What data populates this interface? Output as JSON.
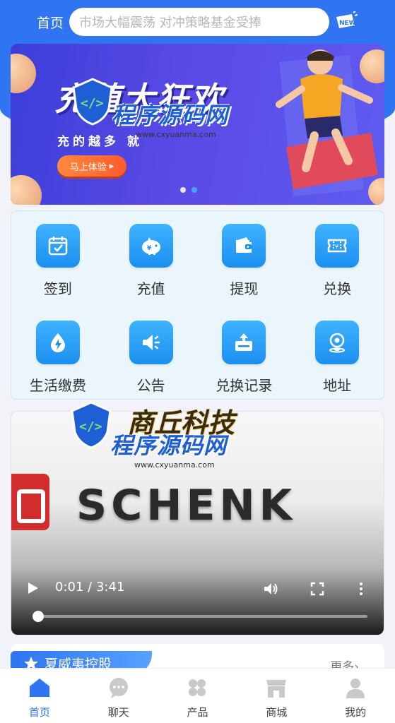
{
  "header": {
    "title": "首页",
    "marquee_text": "市场大幅震荡 对冲策略基金受捧",
    "new_badge": "NEW"
  },
  "banner": {
    "title": "充值大狂欢",
    "subtitle": "充的越多  就",
    "button_label": "马上体验",
    "slides_total": 2,
    "active_slide": 2
  },
  "watermarks": [
    {
      "text": "程序源码网",
      "url": "www.cxyuanma.com"
    },
    {
      "text": "程序源码网",
      "url": "www.cxyuanma.com"
    }
  ],
  "video_watermark_brand": "商丘科技",
  "quick_actions": [
    {
      "label": "签到",
      "icon": "calendar-check-icon"
    },
    {
      "label": "充值",
      "icon": "piggy-bank-icon"
    },
    {
      "label": "提现",
      "icon": "wallet-icon"
    },
    {
      "label": "兑换",
      "icon": "ticket-icon"
    },
    {
      "label": "生活缴费",
      "icon": "flame-drop-icon"
    },
    {
      "label": "公告",
      "icon": "speaker-icon"
    },
    {
      "label": "兑换记录",
      "icon": "upload-box-icon"
    },
    {
      "label": "地址",
      "icon": "location-pin-icon"
    }
  ],
  "video": {
    "brand_text": "SCHENK",
    "current_time": "0:01",
    "separator": "/",
    "duration": "3:41",
    "progress_fraction": 0.005
  },
  "news": {
    "tag_label": "夏威夷控股",
    "more_label": "更多"
  },
  "tabbar": [
    {
      "label": "首页",
      "icon": "home-icon",
      "active": true
    },
    {
      "label": "聊天",
      "icon": "chat-icon",
      "active": false
    },
    {
      "label": "产品",
      "icon": "grid-icon",
      "active": false
    },
    {
      "label": "商城",
      "icon": "store-icon",
      "active": false
    },
    {
      "label": "我的",
      "icon": "user-icon",
      "active": false
    }
  ],
  "colors": {
    "primary": "#2f74f0",
    "icon_tile": "#1b8ff0",
    "card_bg": "#eaf6fc"
  }
}
